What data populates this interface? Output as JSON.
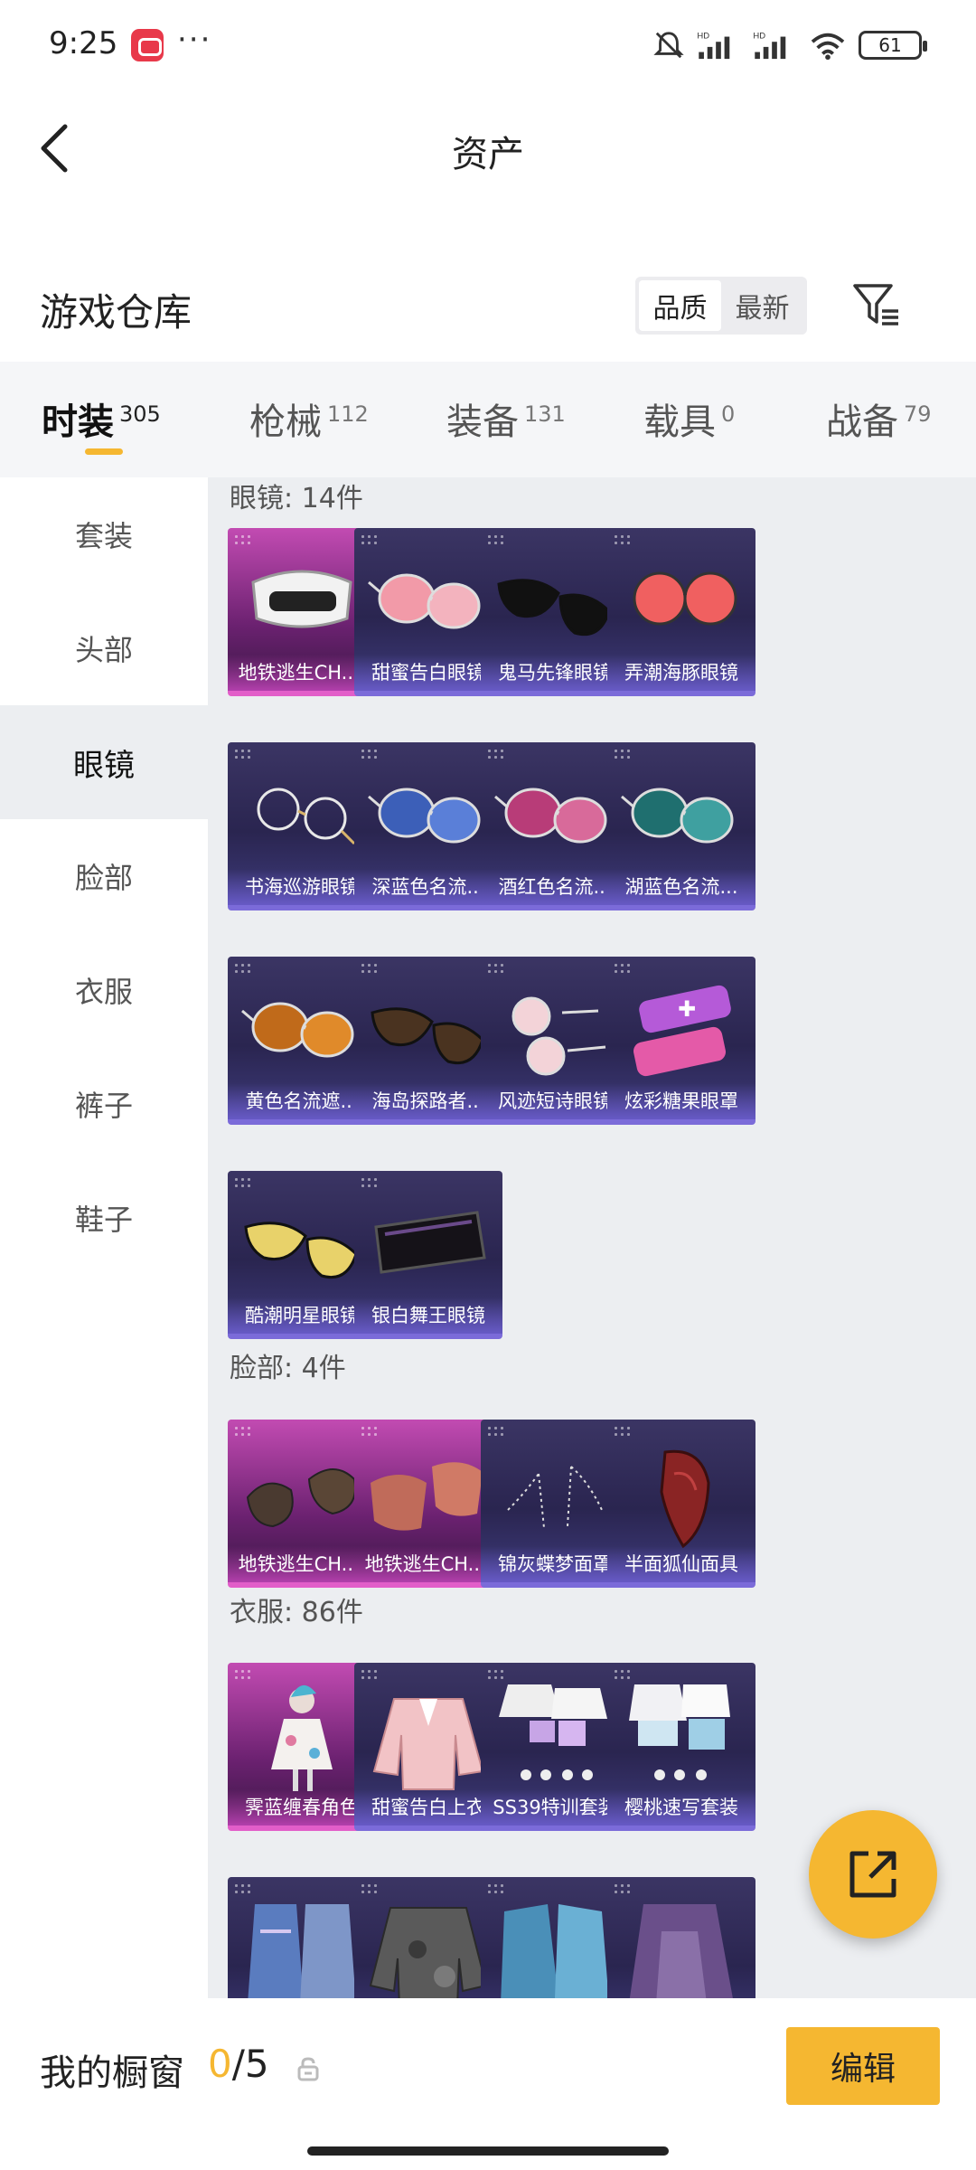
{
  "status": {
    "time": "9:25",
    "dots": "···",
    "battery": "61",
    "icons": [
      "app-notification-icon",
      "mute-icon",
      "signal-hd-icon",
      "signal-hd-icon",
      "wifi-icon",
      "battery-icon"
    ]
  },
  "header": {
    "title": "资产",
    "back_icon": "chevron-left-icon"
  },
  "warehouse": {
    "title": "游戏仓库",
    "sort_options": [
      "品质",
      "最新"
    ],
    "sort_selected": "品质",
    "filter_icon": "filter-icon"
  },
  "category_tabs": [
    {
      "label": "时装",
      "count": "305",
      "active": true
    },
    {
      "label": "枪械",
      "count": "112"
    },
    {
      "label": "装备",
      "count": "131"
    },
    {
      "label": "载具",
      "count": "0"
    },
    {
      "label": "战备",
      "count": "79"
    }
  ],
  "sidebar": {
    "items": [
      "套装",
      "头部",
      "眼镜",
      "脸部",
      "衣服",
      "裤子",
      "鞋子"
    ],
    "selected": "眼镜"
  },
  "sections": [
    {
      "title": "眼镜: 14件",
      "items": [
        {
          "name": "地铁逃生CH....",
          "rarity": "pink",
          "art": "goggles-white-icon"
        },
        {
          "name": "甜蜜告白眼镜",
          "art": "glasses-pink-icon"
        },
        {
          "name": "鬼马先锋眼镜",
          "art": "sunglasses-black-icon"
        },
        {
          "name": "弄潮海豚眼镜",
          "art": "glasses-red-round-icon"
        },
        {
          "name": "书海巡游眼镜",
          "art": "glasses-round-wire-icon"
        },
        {
          "name": "深蓝色名流...",
          "art": "sunglasses-blue-icon"
        },
        {
          "name": "酒红色名流...",
          "art": "sunglasses-wine-icon"
        },
        {
          "name": "湖蓝色名流...",
          "art": "sunglasses-teal-icon"
        },
        {
          "name": "黄色名流遮...",
          "art": "sunglasses-amber-icon"
        },
        {
          "name": "海岛探路者...",
          "art": "sunglasses-brown-icon"
        },
        {
          "name": "风迹短诗眼镜",
          "art": "glasses-pink-round-icon"
        },
        {
          "name": "炫彩糖果眼罩",
          "art": "eye-mask-candy-icon"
        },
        {
          "name": "酷潮明星眼镜",
          "art": "sunglasses-yellow-icon"
        },
        {
          "name": "银白舞王眼镜",
          "art": "visor-black-icon"
        }
      ]
    },
    {
      "title": "脸部: 4件",
      "items": [
        {
          "name": "地铁逃生CH....",
          "rarity": "pink",
          "art": "face-mask-dark-icon"
        },
        {
          "name": "地铁逃生CH....",
          "rarity": "pink",
          "art": "face-scarf-icon"
        },
        {
          "name": "锦灰蝶梦面罩",
          "art": "face-chain-icon"
        },
        {
          "name": "半面狐仙面具",
          "art": "fox-mask-icon"
        }
      ]
    },
    {
      "title": "衣服: 86件",
      "items": [
        {
          "name": "霁蓝缠春角色",
          "rarity": "pink",
          "art": "character-dress-icon"
        },
        {
          "name": "甜蜜告白上衣",
          "art": "jacket-pink-icon"
        },
        {
          "name": "SS39特训套装",
          "art": "outfit-set-icon"
        },
        {
          "name": "樱桃速写套装",
          "art": "outfit-set-blue-icon"
        },
        {
          "name": "",
          "art": "robe-blue-icon"
        },
        {
          "name": "",
          "art": "jacket-camo-icon"
        },
        {
          "name": "",
          "art": "robe-teal-icon"
        },
        {
          "name": "",
          "art": "robe-purple-icon"
        }
      ]
    }
  ],
  "fab": {
    "icon": "share-out-icon"
  },
  "bottom": {
    "label": "我的橱窗",
    "count_current": "0",
    "count_total": "/5",
    "lock_icon": "lock-icon",
    "edit_label": "编辑"
  },
  "colors": {
    "accent": "#f5b731",
    "purple_card": "#2a2550",
    "pink_card": "#c24bb2"
  }
}
